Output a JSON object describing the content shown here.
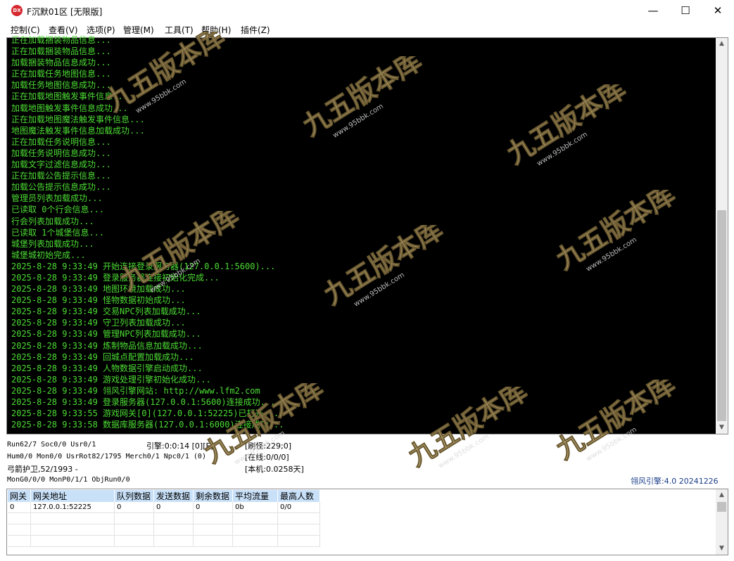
{
  "window": {
    "title": "F沉默01区 [无限版]",
    "icon_label": "DX",
    "minimize": "—",
    "maximize": "☐",
    "close": "✕"
  },
  "menu": [
    {
      "label": "控制(C)"
    },
    {
      "label": "查看(V)"
    },
    {
      "label": "选项(P)"
    },
    {
      "label": "管理(M)"
    },
    {
      "label": "工具(T)"
    },
    {
      "label": "帮助(H)"
    },
    {
      "label": "插件(Z)"
    }
  ],
  "log": [
    "正在加载捆装物品信息...",
    "正在加载捆装物品信息...",
    "加载捆装物品信息成功...",
    "正在加载任务地图信息...",
    "加载任务地图信息成功...",
    "正在加载地图触发事件信息...",
    "加载地图触发事件信息成功...",
    "正在加载地图魔法触发事件信息...",
    "地图魔法触发事件信息加载成功...",
    "正在加载任务说明信息...",
    "加载任务说明信息成功...",
    "加载文字过滤信息成功...",
    "正在加载公告提示信息...",
    "加载公告提示信息成功...",
    "管理员列表加载成功...",
    "已读取 0个行会信息...",
    "行会列表加载成功...",
    "已读取 1个城堡信息...",
    "城堡列表加载成功...",
    "城堡城初始完成...",
    "2025-8-28 9:33:49 开始连接登录服务器(127.0.0.1:5600)...",
    "2025-8-28 9:33:49 登录服务器连接初始化完成...",
    "2025-8-28 9:33:49 地图环境加载成功...",
    "2025-8-28 9:33:49 怪物数据初始成功...",
    "2025-8-28 9:33:49 交易NPC列表加载成功...",
    "2025-8-28 9:33:49 守卫列表加载成功...",
    "2025-8-28 9:33:49 管理NPC列表加载成功...",
    "2025-8-28 9:33:49 炼制物品信息加载成功...",
    "2025-8-28 9:33:49 回城点配置加载成功...",
    "2025-8-28 9:33:49 人物数据引擎启动成功...",
    "2025-8-28 9:33:49 游戏处理引擎初始化成功...",
    "2025-8-28 9:33:49 翎风引擎网站: http://www.lfm2.com",
    "2025-8-28 9:33:49 登录服务器(127.0.0.1:5600)连接成功...",
    "2025-8-28 9:33:55 游戏网关[0](127.0.0.1:52225)已打开...",
    "2025-8-28 9:33:58 数据库服务器(127.0.0.1:6000)连接成功..."
  ],
  "status": {
    "run": "Run62/7 Soc0/0 Usr0/1",
    "engine": "引擎:0:0:14 [0][F]",
    "refresh": "[刷怪:229;0]",
    "hum": "Hum0/0 Mon0/0 UsrRot82/1795 Merch0/1 Npc0/1 (0)",
    "online": "[在线:0/0/0]",
    "guard": "弓箭护卫,52/1993 -",
    "local": "[本机:0.0258天]",
    "mon": "MonG0/0/0 MonP0/1/1 ObjRun0/0",
    "engine_version": "翎风引擎:4.0 20241226"
  },
  "gateway_table": {
    "headers": [
      "网关",
      "网关地址",
      "队列数据",
      "发送数据",
      "剩余数据",
      "平均流量",
      "最高人数"
    ],
    "rows": [
      [
        "0",
        "127.0.0.1:52225",
        "0",
        "0",
        "0",
        "0b",
        "0/0"
      ]
    ]
  },
  "watermark": {
    "text": "九五版本库",
    "url": "www.95bbk.com"
  },
  "colors": {
    "log_text": "#4cdc34",
    "log_bg": "#000000",
    "header_bg": "#c8e0f8",
    "watermark_gold": "#c9b27a"
  }
}
